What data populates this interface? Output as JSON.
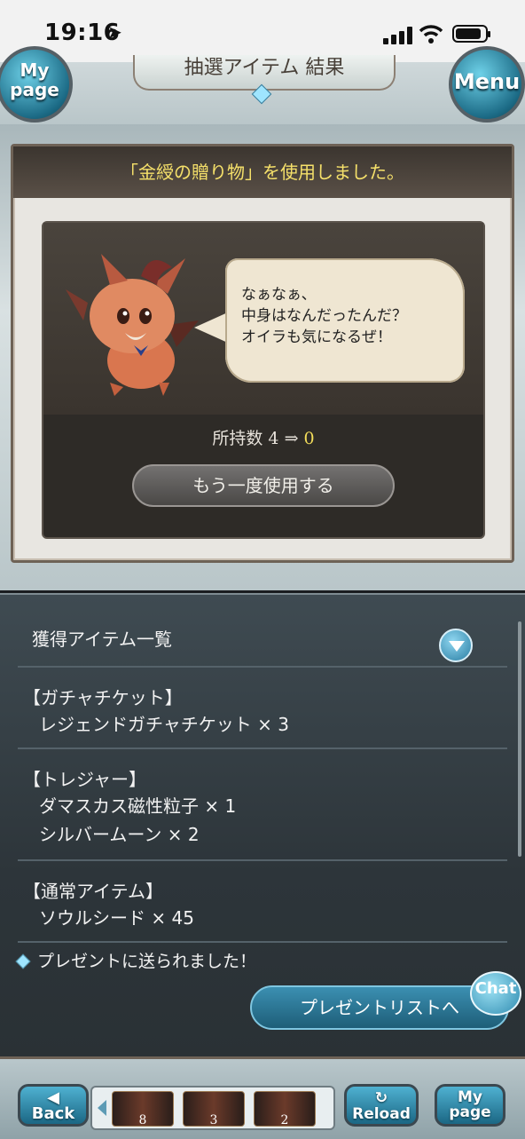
{
  "status_bar": {
    "time": "19:16"
  },
  "header": {
    "title": "抽選アイテム 結果",
    "mypage_label_1": "My",
    "mypage_label_2": "page",
    "menu_label": "Menu"
  },
  "result": {
    "used_message": "「金綬の贈り物」を使用しました。",
    "speech_lines": [
      "なぁなぁ、",
      "中身はなんだったんだ？",
      "オイラも気になるぜ！"
    ],
    "owned_label": "所持数",
    "owned_before": "4",
    "owned_arrow": "⇒",
    "owned_after": "0",
    "use_again_button": "もう一度使用する"
  },
  "obtained": {
    "header": "獲得アイテム一覧",
    "categories": [
      {
        "title": "【ガチャチケット】",
        "items": [
          "レジェンドガチャチケット × 3"
        ]
      },
      {
        "title": "【トレジャー】",
        "items": [
          "ダマスカス磁性粒子 × 1",
          "シルバームーン × 2"
        ]
      },
      {
        "title": "【通常アイテム】",
        "items": [
          "ソウルシード × 45"
        ]
      }
    ],
    "sent_notice": "プレゼントに送られました！",
    "present_button": "プレゼントリストへ"
  },
  "chat_label": "Chat",
  "bottom_nav": {
    "back": "Back",
    "reload": "Reload",
    "mypage_1": "My",
    "mypage_2": "page",
    "shortcut_counts": [
      "8",
      "3",
      "2"
    ]
  },
  "colors": {
    "accent_yellow": "#f3dd5a",
    "button_blue": "#2a7ea3"
  }
}
